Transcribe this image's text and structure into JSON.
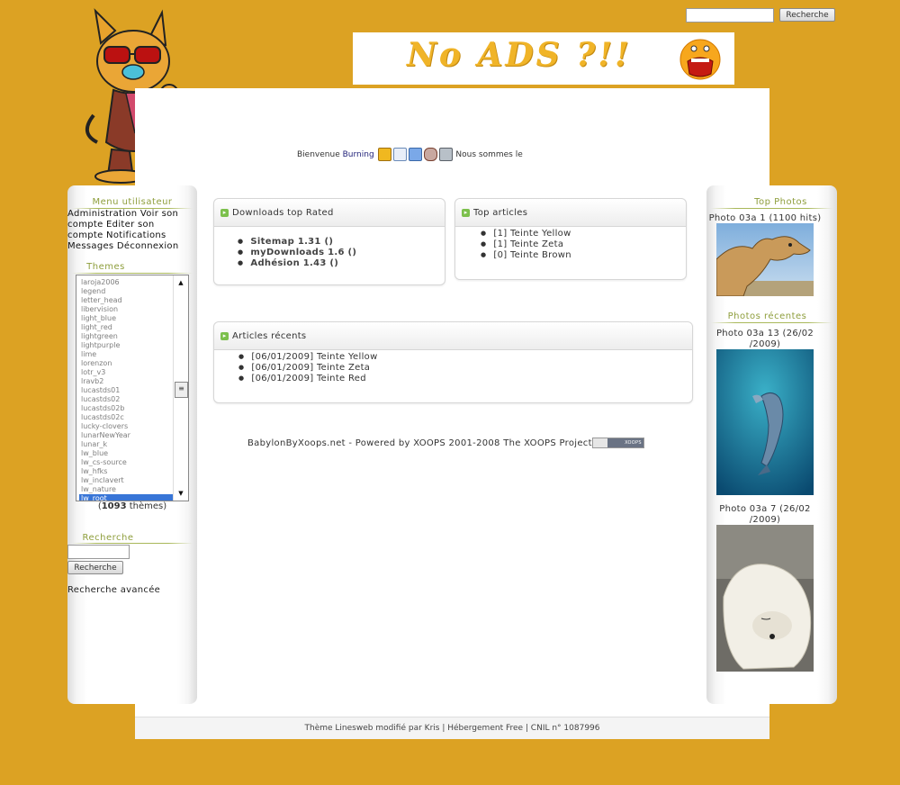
{
  "top_search": {
    "button": "Recherche"
  },
  "banner": {
    "text": "No ADS ?!!"
  },
  "welcome": {
    "prefix": "Bienvenue",
    "user": "Burning",
    "suffix": "Nous sommes le"
  },
  "usermenu": {
    "title": "Menu utilisateur",
    "text": "Administration Voir son compte Editer son compte Notifications Messages Déconnexion"
  },
  "themes": {
    "title": "Themes",
    "items": [
      "laroja2006",
      "legend",
      "letter_head",
      "libervision",
      "light_blue",
      "light_red",
      "lightgreen",
      "lightpurple",
      "lime",
      "lorenzon",
      "lotr_v3",
      "lravb2",
      "lucastds01",
      "lucastds02",
      "lucastds02b",
      "lucastds02c",
      "lucky-clovers",
      "lunarNewYear",
      "lunar_k",
      "lw_blue",
      "lw_cs-source",
      "lw_hfks",
      "lw_inclavert",
      "lw_nature",
      "lw_root"
    ],
    "selected": "lw_root",
    "count_open": "(",
    "count": "1093",
    "count_close": " thèmes)"
  },
  "left_search": {
    "title": "Recherche",
    "button": "Recherche",
    "advanced": "Recherche avancée"
  },
  "downloads": {
    "title": "Downloads top Rated",
    "items": [
      "Sitemap 1.31 ()",
      "myDownloads 1.6 ()",
      "Adhésion 1.43 ()"
    ]
  },
  "top_articles": {
    "title": "Top articles",
    "items": [
      "[1] Teinte Yellow",
      "[1] Teinte Zeta",
      "[0] Teinte Brown"
    ]
  },
  "recent_articles": {
    "title": "Articles récents",
    "items": [
      "[06/01/2009] Teinte Yellow",
      "[06/01/2009] Teinte Zeta",
      "[06/01/2009] Teinte Red"
    ]
  },
  "powered": {
    "text": "BabylonByXoops.net - Powered by XOOPS 2001-2008 The XOOPS Project",
    "badge": "XOOPS"
  },
  "top_photos": {
    "title": "Top Photos",
    "caption": "Photo 03a 1 (1100 hits)"
  },
  "recent_photos": {
    "title": "Photos récentes",
    "captions": [
      "Photo 03a 13 (26/02 /2009)",
      "Photo 03a 7 (26/02 /2009)"
    ]
  },
  "footer": {
    "text": "Thème Linesweb modifié par Kris | Hébergement Free | CNIL n° 1087996"
  }
}
